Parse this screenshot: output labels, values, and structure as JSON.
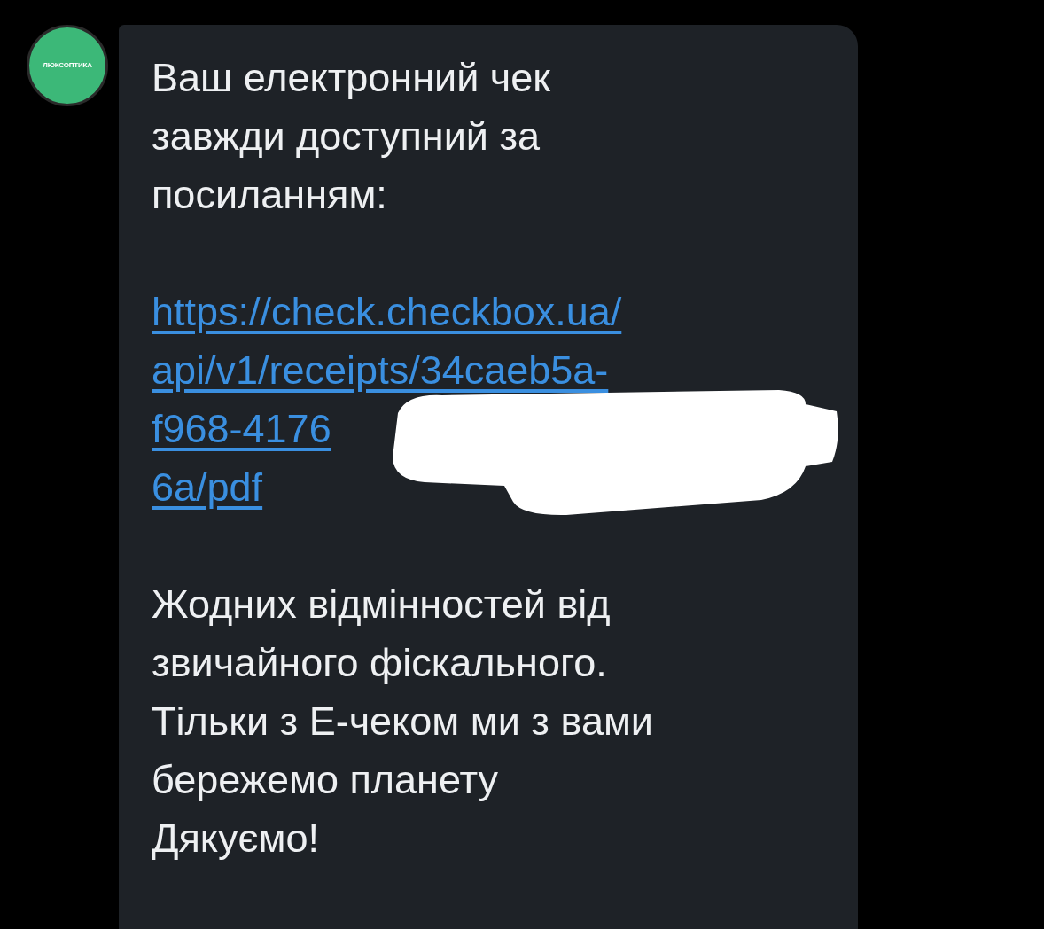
{
  "sender": {
    "avatar_text": "ЛЮКСОПТИКА"
  },
  "message": {
    "paragraphs": [
      [
        "Ваш електронний чек",
        "завжди доступний за",
        "посиланням:"
      ]
    ],
    "link_lines": [
      "https://check.checkbox.ua/",
      "api/v1/receipts/34caeb5a-",
      "f968-4176",
      "6a/pdf"
    ],
    "closing": [
      "Жодних відмінностей від",
      "звичайного фіскального.",
      "Тільки з Е-чеком ми з вами",
      "бережемо планету",
      "Дякуємо!"
    ]
  }
}
